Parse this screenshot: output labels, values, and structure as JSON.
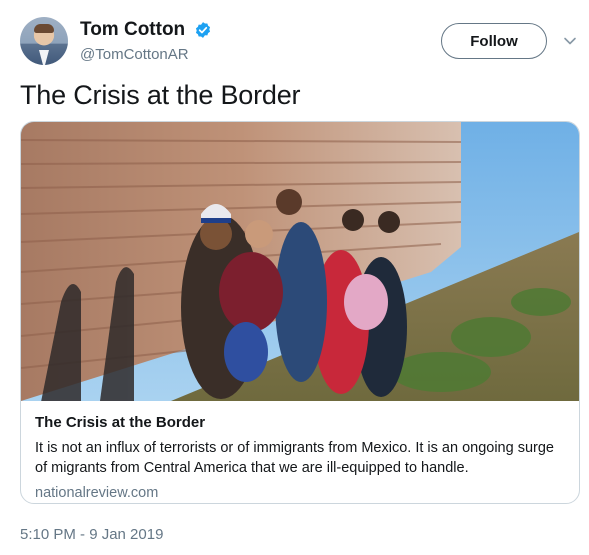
{
  "author": {
    "display_name": "Tom Cotton",
    "handle": "@TomCottonAR",
    "verified": true
  },
  "follow_label": "Follow",
  "tweet_text": "The Crisis at the Border",
  "card": {
    "title": "The Crisis at the Border",
    "description": "It is not an influx of terrorists or of immigrants from Mexico. It is an ongoing surge of migrants from Central America that we are ill-equipped to handle.",
    "domain": "nationalreview.com"
  },
  "timestamp": "5:10 PM - 9 Jan 2019",
  "colors": {
    "verified_blue": "#1da1f2",
    "secondary_text": "#657786",
    "border": "#ccd6dd"
  },
  "icons": [
    "verified-badge-icon",
    "chevron-down-icon"
  ]
}
